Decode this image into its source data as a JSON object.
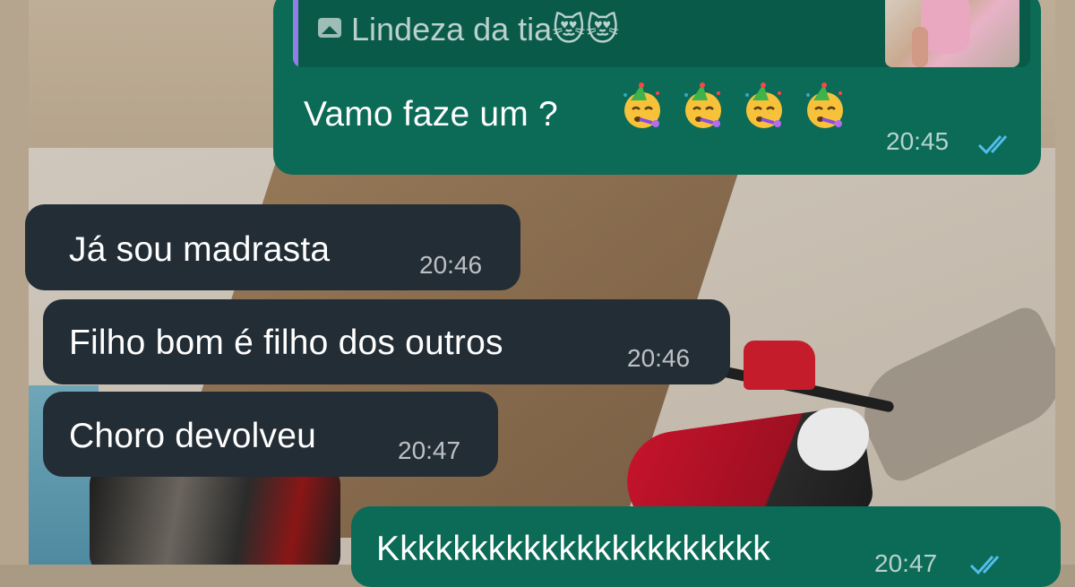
{
  "messages": [
    {
      "direction": "outgoing",
      "quoted": {
        "icon": "image-icon",
        "text": "Lindeza da tia😻😻"
      },
      "text": "Vamo faze um ?",
      "emojis": [
        "partying-face",
        "partying-face",
        "partying-face",
        "partying-face"
      ],
      "time": "20:45",
      "status": "read"
    },
    {
      "direction": "incoming",
      "text": "Já sou madrasta",
      "time": "20:46"
    },
    {
      "direction": "incoming",
      "text": "Filho bom é filho dos outros",
      "time": "20:46"
    },
    {
      "direction": "incoming",
      "text": "Choro devolveu",
      "time": "20:47"
    },
    {
      "direction": "outgoing",
      "text": "Kkkkkkkkkkkkkkkkkkkkkk",
      "time": "20:47",
      "status": "read"
    }
  ],
  "colors": {
    "outgoing_bubble": "#0b6b57",
    "incoming_bubble": "#232d36",
    "quote_accent": "#8f7fe6",
    "read_ticks": "#53bdeb"
  }
}
